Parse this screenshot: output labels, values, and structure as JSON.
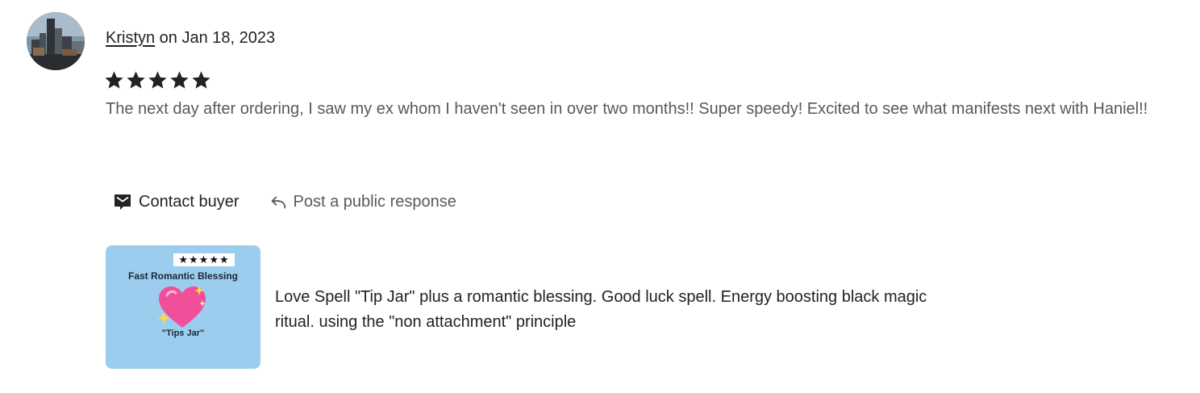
{
  "reviewer": {
    "name": "Kristyn",
    "date_text": " on Jan 18, 2023"
  },
  "rating": {
    "value": 5,
    "max": 5,
    "icon": "star-icon"
  },
  "review": {
    "text": "The next day after ordering, I saw my ex whom I haven't seen in over two months!! Super speedy! Excited to see what manifests next with Haniel!!"
  },
  "actions": {
    "contact_label": "Contact buyer",
    "contact_icon": "mail-icon",
    "respond_label": "Post a public response",
    "respond_icon": "reply-arrow-icon"
  },
  "listing": {
    "thumb_stars": "★★★★★",
    "thumb_title": "Fast Romantic Blessing",
    "thumb_icon": "sparkling-heart-icon",
    "thumb_caption": "\"Tips Jar\"",
    "title": "Love Spell \"Tip Jar\" plus a romantic blessing. Good luck spell. Energy boosting black magic ritual. using the \"non attachment\" principle"
  },
  "colors": {
    "text_primary": "#222222",
    "text_secondary": "#595959",
    "thumb_background": "#9ccdee",
    "heart": "#f0509a"
  }
}
